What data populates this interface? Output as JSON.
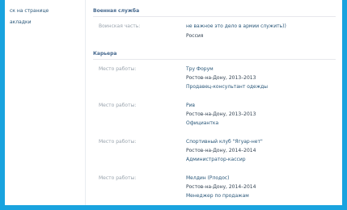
{
  "sidebar": {
    "items": [
      {
        "label": "ск на странице"
      },
      {
        "label": "акладки"
      }
    ]
  },
  "military": {
    "title": "Военная служба",
    "label": "Воинская часть:",
    "value_line1": "не важное это дело в армии служить))",
    "value_line2": "Россия"
  },
  "career": {
    "title": "Карьера",
    "jobs": [
      {
        "label": "Место работы:",
        "company": "Тру Форум",
        "city": "Ростов-на-Дону, 2013–2013",
        "position": "Продавец-консультант одежды"
      },
      {
        "label": "Место работы:",
        "company": "Рив",
        "city": "Ростов-на-Дону, 2013–2013",
        "position": "Официантка"
      },
      {
        "label": "Место работы:",
        "company": "Спортивный клуб \"Ягуар-нет\"",
        "city": "Ростов-на-Дону, 2014–2014",
        "position": "Администратор-кассир"
      },
      {
        "label": "Место работы:",
        "company": "Мелдин (Рлодос)",
        "city": "Ростов-на-Дону, 2014–2014",
        "position": "Менеджер по продажам"
      }
    ]
  },
  "colors": {
    "frame_border": "#19a3df",
    "link": "#2b587a",
    "section_title": "#45688e",
    "label": "#9aa4ae",
    "text": "#2f3f4f"
  }
}
